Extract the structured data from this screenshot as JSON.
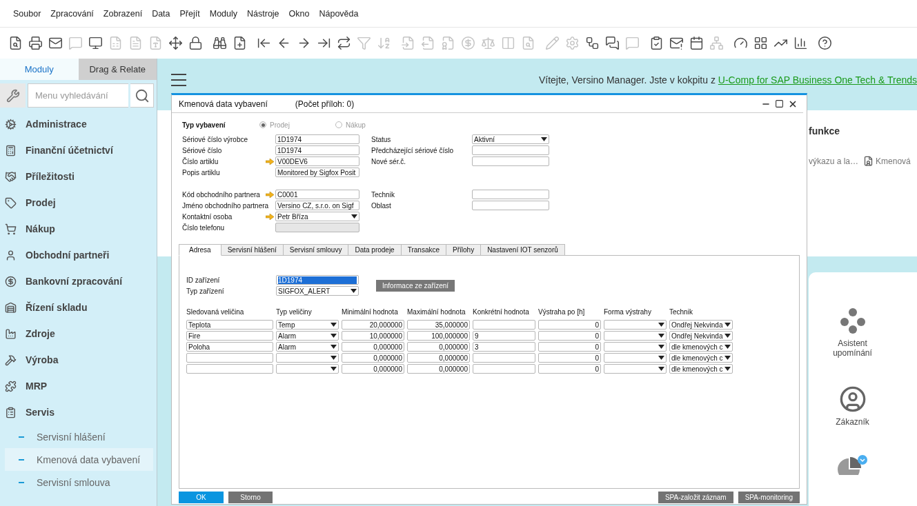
{
  "menu": [
    "Soubor",
    "Zpracování",
    "Zobrazení",
    "Data",
    "Přejít",
    "Moduly",
    "Nástroje",
    "Okno",
    "Nápověda"
  ],
  "toolbar": [
    {
      "disabled": false
    },
    {
      "disabled": false
    },
    {
      "disabled": false
    },
    {
      "disabled": true
    },
    {
      "disabled": false
    },
    {
      "disabled": true
    },
    {
      "disabled": true
    },
    {
      "disabled": true
    },
    {
      "disabled": false
    },
    {
      "disabled": false
    },
    {
      "disabled": false
    },
    {
      "disabled": false
    },
    {
      "disabled": false
    },
    {
      "disabled": false
    },
    {
      "disabled": false
    },
    {
      "disabled": false
    },
    {
      "disabled": false
    },
    {
      "disabled": true
    },
    {
      "disabled": true
    },
    {
      "disabled": true
    },
    {
      "disabled": true
    },
    {
      "disabled": true
    },
    {
      "disabled": true
    },
    {
      "disabled": true
    },
    {
      "disabled": true
    },
    {
      "disabled": true
    },
    {
      "disabled": true
    },
    {
      "disabled": true
    },
    {
      "disabled": false
    },
    {
      "disabled": false
    },
    {
      "disabled": true
    },
    {
      "disabled": false
    },
    {
      "disabled": false
    },
    {
      "disabled": false
    },
    {
      "disabled": true
    },
    {
      "disabled": false
    },
    {
      "disabled": false
    },
    {
      "disabled": false
    },
    {
      "disabled": false
    },
    {
      "disabled": false
    }
  ],
  "sidebar": {
    "tabs": [
      {
        "label": "Moduly",
        "selected": true
      },
      {
        "label": "Drag & Relate",
        "selected": false
      }
    ],
    "search": {
      "placeholder": "Menu vyhledávání"
    },
    "modules": [
      {
        "label": "Administrace"
      },
      {
        "label": "Finanční účetnictví"
      },
      {
        "label": "Příležitosti"
      },
      {
        "label": "Prodej"
      },
      {
        "label": "Nákup"
      },
      {
        "label": "Obchodní partneři"
      },
      {
        "label": "Bankovní zpracování"
      },
      {
        "label": "Řízení skladu"
      },
      {
        "label": "Zdroje"
      },
      {
        "label": "Výroba"
      },
      {
        "label": "MRP"
      },
      {
        "label": "Servis",
        "children": [
          {
            "label": "Servisní hlášení",
            "selected": false
          },
          {
            "label": "Kmenová data vybavení",
            "selected": true
          },
          {
            "label": "Servisní smlouva",
            "selected": false
          }
        ]
      }
    ]
  },
  "cockpit": {
    "welcome": "Vítejte, Versino Manager. Jste v kokpitu z ",
    "link": "U-Comp for SAP Business One Tech & Trends",
    "functions_title": "funkce",
    "functions": [
      "výkazu a la…",
      "Kmenová"
    ],
    "widgets": [
      {
        "label": "Asistent upomínání"
      },
      {
        "label": "Zákazník"
      }
    ]
  },
  "dialog": {
    "title": "Kmenová data vybavení",
    "attachments": "(Počet příloh: 0)",
    "type": {
      "label": "Typ vybavení",
      "disabled": true,
      "options": [
        {
          "label": "Prodej",
          "selected": true
        },
        {
          "label": "Nákup",
          "selected": false
        }
      ]
    },
    "sections": [
      {
        "left": [
          {
            "label": "Sériové číslo výrobce",
            "value": "1D1974",
            "kind": "text",
            "link": false
          },
          {
            "label": "Sériové číslo",
            "value": "1D1974",
            "kind": "text",
            "link": false
          },
          {
            "label": "Číslo artiklu",
            "value": "V00DEV6",
            "kind": "text",
            "link": true
          },
          {
            "label": "Popis artiklu",
            "value": "Monitored by Sigfox Posit",
            "kind": "text",
            "link": false
          }
        ],
        "right": [
          {
            "label": "Status",
            "value": "Aktivní",
            "kind": "dropdown",
            "link": false
          },
          {
            "label": "Předcházející sériové číslo",
            "kind": "text",
            "link": false
          },
          {
            "label": "Nové sér.č.",
            "kind": "text",
            "link": false
          }
        ]
      },
      {
        "left": [
          {
            "label": "Kód obchodního partnera",
            "value": "C0001",
            "kind": "text",
            "link": true
          },
          {
            "label": "Jméno obchodního partnera",
            "value": "Versino CZ, s.r.o. on Sigf",
            "kind": "text",
            "link": false
          },
          {
            "label": "Kontaktní osoba",
            "value": "Petr Bříza",
            "kind": "dropdown",
            "link": true
          },
          {
            "label": "Číslo telefonu",
            "kind": "readonly",
            "link": false
          }
        ],
        "right": [
          {
            "label": "Technik",
            "kind": "text",
            "link": false
          },
          {
            "label": "Oblast",
            "kind": "text",
            "link": false
          }
        ]
      }
    ],
    "tabs": [
      {
        "label": "Adresa",
        "selected": true
      },
      {
        "label": "Servisní hlášení",
        "selected": false
      },
      {
        "label": "Servisní smlouvy",
        "selected": false
      },
      {
        "label": "Data prodeje",
        "selected": false
      },
      {
        "label": "Transakce",
        "selected": false
      },
      {
        "label": "Přílohy",
        "selected": false
      },
      {
        "label": "Nastavení IOT senzorů",
        "selected": false
      }
    ],
    "device_id": {
      "label": "ID zařízení",
      "value": "1D1974",
      "highlighted": true
    },
    "device_type": {
      "label": "Typ zařízení",
      "value": "SIGFOX_ALERT"
    },
    "info_button": "Informace ze zařízení",
    "table": {
      "columns": [
        {
          "label": "Sledovaná veličina",
          "kind": "text"
        },
        {
          "label": "Typ veličiny",
          "kind": "dropdown"
        },
        {
          "label": "Minimální hodnota",
          "kind": "number"
        },
        {
          "label": "Maximální hodnota",
          "kind": "number"
        },
        {
          "label": "Konkrétní hodnota",
          "kind": "text"
        },
        {
          "label": "Výstraha po [h]",
          "kind": "number"
        },
        {
          "label": "Forma výstrahy",
          "kind": "dropdown"
        },
        {
          "label": "Technik",
          "kind": "dropdown"
        }
      ],
      "rows": [
        {
          "cells": [
            {
              "text": "Teplota"
            },
            {
              "text": "Temp"
            },
            {
              "text": "20,000000"
            },
            {
              "text": "35,000000"
            },
            {},
            {
              "text": "0"
            },
            {},
            {
              "text": "Ondřej Nekvinda"
            }
          ]
        },
        {
          "cells": [
            {
              "text": "Fire"
            },
            {
              "text": "Alarm"
            },
            {
              "text": "10,000000"
            },
            {
              "text": "100,000000"
            },
            {
              "text": "9"
            },
            {
              "text": "0"
            },
            {},
            {
              "text": "Ondřej Nekvinda"
            }
          ]
        },
        {
          "cells": [
            {
              "text": "Poloha"
            },
            {
              "text": "Alarm"
            },
            {
              "text": "0,000000"
            },
            {
              "text": "0,000000"
            },
            {
              "text": "3"
            },
            {
              "text": "0"
            },
            {},
            {
              "text": "dle kmenových c"
            }
          ]
        },
        {
          "cells": [
            {},
            {},
            {
              "text": "0,000000"
            },
            {
              "text": "0,000000"
            },
            {},
            {
              "text": "0"
            },
            {},
            {
              "text": "dle kmenových c"
            }
          ]
        },
        {
          "cells": [
            {},
            {},
            {
              "text": "0,000000"
            },
            {
              "text": "0,000000"
            },
            {},
            {
              "text": "0"
            },
            {},
            {
              "text": "dle kmenových c"
            }
          ]
        }
      ]
    },
    "buttons_left": [
      {
        "label": "OK",
        "kind": "primary"
      },
      {
        "label": "Storno",
        "kind": "secondary"
      }
    ],
    "buttons_right": [
      {
        "label": "SPA-založit záznam",
        "kind": "secondary"
      },
      {
        "label": "SPA-monitoring",
        "kind": "secondary"
      }
    ]
  }
}
